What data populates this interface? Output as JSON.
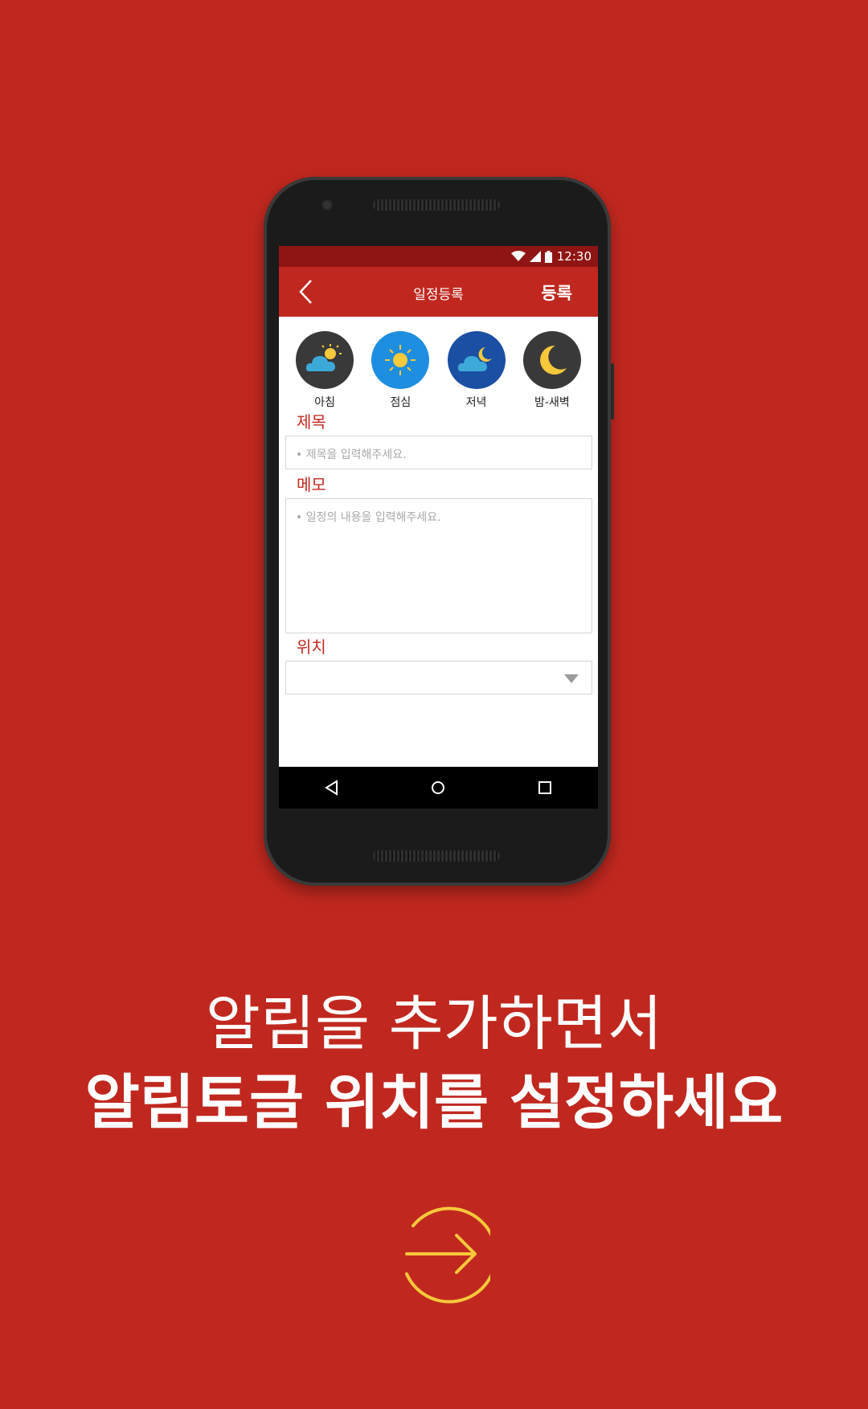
{
  "status_bar": {
    "time": "12:30",
    "icons": [
      "wifi-icon",
      "signal-icon",
      "battery-icon"
    ]
  },
  "app_bar": {
    "title": "일정등록",
    "action_label": "등록",
    "back_icon": "chevron-left-icon"
  },
  "time_options": [
    {
      "label": "아침",
      "icon": "cloud-sun-icon"
    },
    {
      "label": "점심",
      "icon": "sun-icon"
    },
    {
      "label": "저녁",
      "icon": "cloud-moon-icon"
    },
    {
      "label": "밤-새벽",
      "icon": "moon-icon"
    }
  ],
  "form": {
    "title_label": "제목",
    "title_placeholder": "• 제목을 입력해주세요.",
    "memo_label": "메모",
    "memo_placeholder": "• 일정의 내용을 입력해주세요.",
    "location_label": "위치",
    "location_value": ""
  },
  "nav_bar": {
    "items": [
      "back-icon",
      "home-icon",
      "recents-icon"
    ]
  },
  "headline": {
    "line1": "알림을 추가하면서",
    "line2": "알림토글 위치를 설정하세요"
  },
  "colors": {
    "background": "#c0281f",
    "status_bar": "#8e1514",
    "accent_arrow": "#f6c83a"
  }
}
